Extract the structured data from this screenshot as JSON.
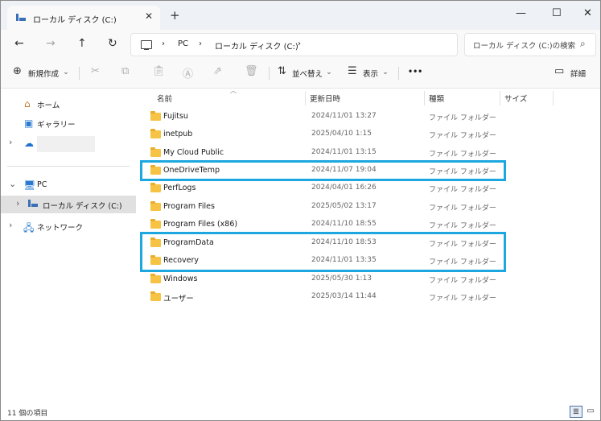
{
  "titlebar": {
    "tab_title": "ローカル ディスク (C:)",
    "tab_close": "✕",
    "new_tab": "+",
    "minimize": "—",
    "maximize": "☐",
    "close": "✕"
  },
  "addressbar": {
    "back": "←",
    "forward": "→",
    "up": "↑",
    "refresh": "↻",
    "breadcrumbs": [
      "PC",
      "ローカル ディスク (C:)"
    ],
    "separator": "›",
    "search_placeholder": "ローカル ディスク (C:)の検索",
    "search_icon": "⌕"
  },
  "commandbar": {
    "new_label": "新規作成",
    "sort_label": "並べ替え",
    "view_label": "表示",
    "more_label": "•••",
    "details_label": "詳細",
    "dropdown": "⌄"
  },
  "nav": {
    "home": "ホーム",
    "gallery": "ギャラリー",
    "pc": "PC",
    "local_disk": "ローカル ディスク (C:)",
    "network": "ネットワーク",
    "chevron_right": "›",
    "chevron_down": "⌄"
  },
  "columns": {
    "name": "名前",
    "date": "更新日時",
    "type": "種類",
    "size": "サイズ"
  },
  "files": [
    {
      "name": "Fujitsu",
      "date": "2024/11/01 13:27",
      "type": "ファイル フォルダー"
    },
    {
      "name": "inetpub",
      "date": "2025/04/10 1:15",
      "type": "ファイル フォルダー"
    },
    {
      "name": "My Cloud Public",
      "date": "2024/11/01 13:15",
      "type": "ファイル フォルダー"
    },
    {
      "name": "OneDriveTemp",
      "date": "2024/11/07 19:04",
      "type": "ファイル フォルダー"
    },
    {
      "name": "PerfLogs",
      "date": "2024/04/01 16:26",
      "type": "ファイル フォルダー"
    },
    {
      "name": "Program Files",
      "date": "2025/05/02 13:17",
      "type": "ファイル フォルダー"
    },
    {
      "name": "Program Files (x86)",
      "date": "2024/11/10 18:55",
      "type": "ファイル フォルダー"
    },
    {
      "name": "ProgramData",
      "date": "2024/11/10 18:53",
      "type": "ファイル フォルダー"
    },
    {
      "name": "Recovery",
      "date": "2024/11/01 13:35",
      "type": "ファイル フォルダー"
    },
    {
      "name": "Windows",
      "date": "2025/05/30 1:13",
      "type": "ファイル フォルダー"
    },
    {
      "name": "ユーザー",
      "date": "2025/03/14 11:44",
      "type": "ファイル フォルダー"
    }
  ],
  "highlight_color": "#1ca7e0",
  "statusbar": {
    "item_count": "11 個の項目"
  },
  "icons": {
    "new": "plus-circle-icon",
    "cut": "scissors-icon",
    "copy": "copy-icon",
    "paste": "paste-icon",
    "rename": "rename-icon",
    "share": "share-icon",
    "delete": "trash-icon",
    "sort": "sort-icon",
    "view": "view-icon",
    "details": "details-pane-icon"
  }
}
